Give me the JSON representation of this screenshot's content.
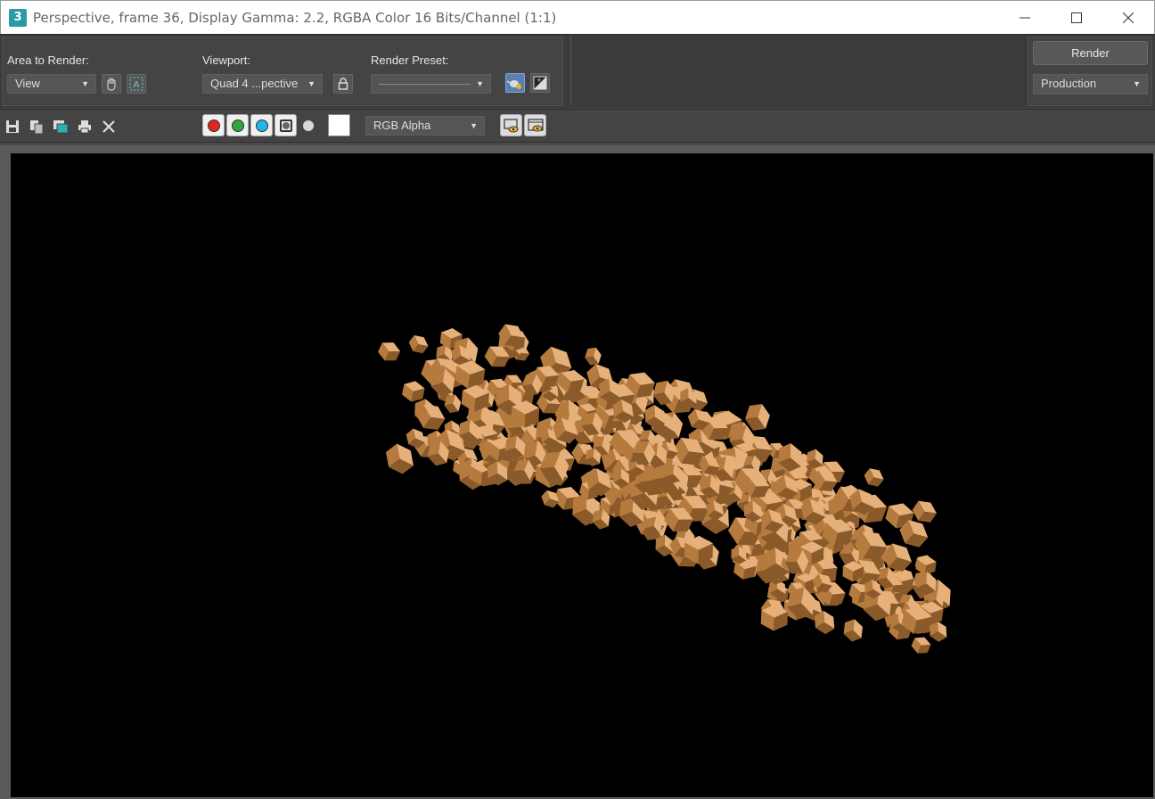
{
  "window": {
    "title": "Perspective, frame 36, Display Gamma: 2.2, RGBA Color 16 Bits/Channel (1:1)",
    "app_icon_text": "3",
    "minimize_icon": "minimize-icon",
    "maximize_icon": "maximize-icon",
    "close_icon": "close-icon"
  },
  "render_settings": {
    "area_label": "Area to Render:",
    "area_value": "View",
    "viewport_label": "Viewport:",
    "viewport_value": "Quad 4 ...pective",
    "preset_label": "Render Preset:",
    "preset_value": "",
    "render_button": "Render",
    "render_mode": "Production"
  },
  "toolbar": {
    "channel_display": "RGB Alpha",
    "icons": [
      "save-icon",
      "copy-icon",
      "clone-icon",
      "print-icon",
      "clear-icon"
    ],
    "channels": [
      {
        "name": "red",
        "color": "#e02525",
        "enabled": true
      },
      {
        "name": "green",
        "color": "#2fa83a",
        "enabled": true
      },
      {
        "name": "blue",
        "color": "#1fb6e8",
        "enabled": true
      }
    ]
  },
  "render": {
    "background": "#000000",
    "subject": "particle cubes",
    "cube_color": "#c98a48"
  }
}
